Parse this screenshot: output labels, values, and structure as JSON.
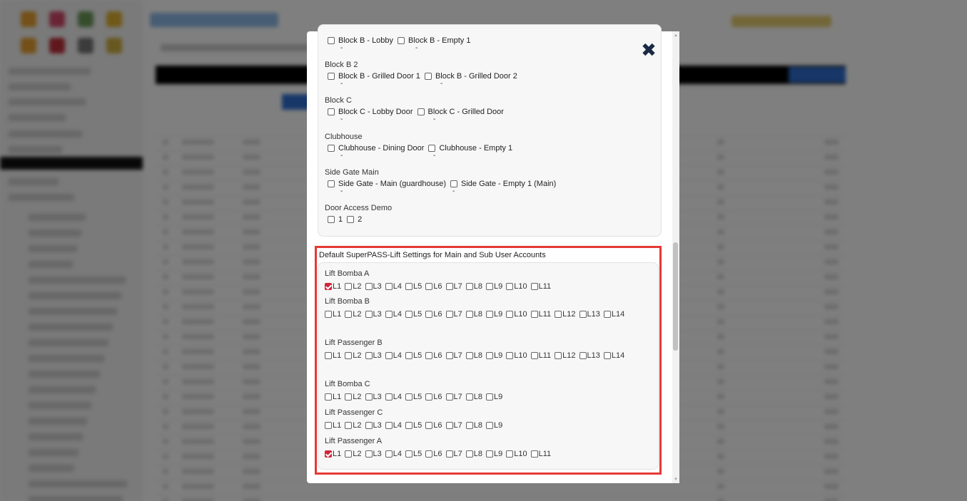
{
  "modal": {
    "close_glyph": "✖",
    "door_groups": [
      {
        "title": "",
        "doors": [
          {
            "label": "Block B - Lobby",
            "value": "-"
          },
          {
            "label": "Block B - Empty 1",
            "value": "-"
          }
        ]
      },
      {
        "title": "Block B 2",
        "doors": [
          {
            "label": "Block B - Grilled Door 1",
            "value": "-"
          },
          {
            "label": "Block B - Grilled Door 2",
            "value": "-"
          }
        ]
      },
      {
        "title": "Block C",
        "doors": [
          {
            "label": "Block C - Lobby Door",
            "value": "-"
          },
          {
            "label": "Block C - Grilled Door",
            "value": "-"
          }
        ]
      },
      {
        "title": "Clubhouse",
        "doors": [
          {
            "label": "Clubhouse - Dining Door",
            "value": "-"
          },
          {
            "label": "Clubhouse - Empty 1",
            "value": "-"
          }
        ]
      },
      {
        "title": "Side Gate Main",
        "doors": [
          {
            "label": "Side Gate - Main (guardhouse)",
            "value": "-"
          },
          {
            "label": "Side Gate - Empty 1 (Main)",
            "value": "-"
          }
        ]
      },
      {
        "title": "Door Access Demo",
        "doors": [
          {
            "label": "1",
            "value": ""
          },
          {
            "label": "2",
            "value": ""
          }
        ]
      }
    ],
    "lift_section_title": "Default SuperPASS-Lift Settings for Main and Sub User Accounts",
    "lift_groups": [
      {
        "title": "Lift Bomba A",
        "levels": [
          "L1",
          "L2",
          "L3",
          "L4",
          "L5",
          "L6",
          "L7",
          "L8",
          "L9",
          "L10",
          "L11"
        ],
        "checked": [
          "L1"
        ]
      },
      {
        "title": "Lift Bomba B",
        "levels": [
          "L1",
          "L2",
          "L3",
          "L4",
          "L5",
          "L6",
          "L7",
          "L8",
          "L9",
          "L10",
          "L11",
          "L12",
          "L13",
          "L14"
        ],
        "checked": []
      },
      {
        "title": "Lift Passenger B",
        "levels": [
          "L1",
          "L2",
          "L3",
          "L4",
          "L5",
          "L6",
          "L7",
          "L8",
          "L9",
          "L10",
          "L11",
          "L12",
          "L13",
          "L14"
        ],
        "checked": []
      },
      {
        "title": "Lift Bomba C",
        "levels": [
          "L1",
          "L2",
          "L3",
          "L4",
          "L5",
          "L6",
          "L7",
          "L8",
          "L9"
        ],
        "checked": []
      },
      {
        "title": "Lift Passenger C",
        "levels": [
          "L1",
          "L2",
          "L3",
          "L4",
          "L5",
          "L6",
          "L7",
          "L8",
          "L9"
        ],
        "checked": []
      },
      {
        "title": "Lift Passenger A",
        "levels": [
          "L1",
          "L2",
          "L3",
          "L4",
          "L5",
          "L6",
          "L7",
          "L8",
          "L9",
          "L10",
          "L11"
        ],
        "checked": [
          "L1"
        ]
      }
    ]
  },
  "colors": {
    "checked": "#d0263a",
    "highlight_border": "#e53935",
    "close": "#1a2a44"
  }
}
